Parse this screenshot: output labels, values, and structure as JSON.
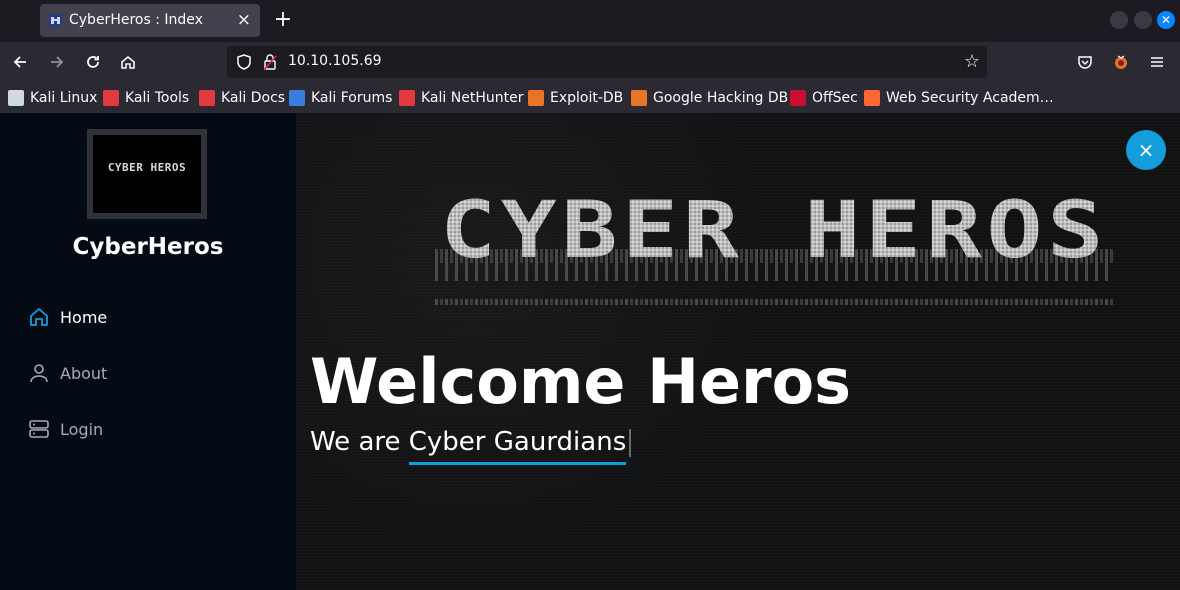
{
  "browser": {
    "tab_title": "CyberHeros : Index",
    "tab_close": "×",
    "new_tab": "+",
    "url": "10.10.105.69",
    "bookmarks": [
      {
        "label": "Kali Linux",
        "icon": "kali-icon",
        "color": "#cfd8e3"
      },
      {
        "label": "Kali Tools",
        "icon": "kali-tools-icon",
        "color": "#e03a3e"
      },
      {
        "label": "Kali Docs",
        "icon": "kali-docs-icon",
        "color": "#e03a3e"
      },
      {
        "label": "Kali Forums",
        "icon": "kali-forums-icon",
        "color": "#3b7ddd"
      },
      {
        "label": "Kali NetHunter",
        "icon": "nethunter-icon",
        "color": "#e03a3e"
      },
      {
        "label": "Exploit-DB",
        "icon": "exploit-db-icon",
        "color": "#e8742a"
      },
      {
        "label": "Google Hacking DB",
        "icon": "ghdb-icon",
        "color": "#e8742a"
      },
      {
        "label": "OffSec",
        "icon": "offsec-icon",
        "color": "#c8102e"
      },
      {
        "label": "Web Security Academ…",
        "icon": "portswigger-icon",
        "color": "#ff6633"
      }
    ]
  },
  "sidebar": {
    "logo_text": "CYBER HEROS",
    "site_name": "CyberHeros",
    "items": [
      {
        "label": "Home",
        "icon": "home-icon",
        "active": true
      },
      {
        "label": "About",
        "icon": "user-icon",
        "active": false
      },
      {
        "label": "Login",
        "icon": "server-icon",
        "active": false
      }
    ]
  },
  "hero": {
    "art_text": "CYBER HEROS",
    "title": "Welcome Heros",
    "subtitle_prefix": "We are ",
    "subtitle_typed": "Cyber Gaurdians",
    "close_label": "×"
  },
  "colors": {
    "accent": "#149ddd",
    "sidebar_bg": "#040b14",
    "hero_bg": "#111214"
  }
}
